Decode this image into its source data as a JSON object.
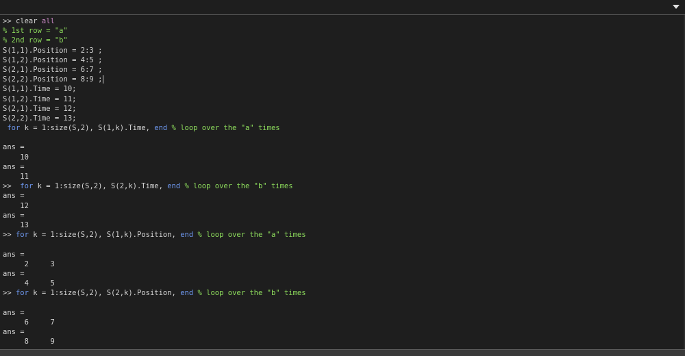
{
  "colors": {
    "background": "#1e1e1e",
    "text": "#d4d4d4",
    "comment": "#8bd85b",
    "keyword": "#6c95eb",
    "string_keyword": "#c586c0"
  },
  "toolbar": {
    "dropdown_icon": "chevron-down-icon"
  },
  "console": {
    "lines": [
      [
        {
          "t": ">> clear ",
          "c": "white"
        },
        {
          "t": "all",
          "c": "violet"
        }
      ],
      [
        {
          "t": "% 1st row = \"a\"",
          "c": "green"
        }
      ],
      [
        {
          "t": "% 2nd row = \"b\"",
          "c": "green"
        }
      ],
      [
        {
          "t": "S(1,1).Position = 2:3 ;",
          "c": "white"
        }
      ],
      [
        {
          "t": "S(1,2).Position = 4:5 ;",
          "c": "white"
        }
      ],
      [
        {
          "t": "S(2,1).Position = 6:7 ;",
          "c": "white"
        }
      ],
      [
        {
          "t": "S(2,2).Position = 8:9 ;",
          "c": "white"
        },
        {
          "caret": true
        }
      ],
      [
        {
          "t": "S(1,1).Time = 10;",
          "c": "white"
        }
      ],
      [
        {
          "t": "S(1,2).Time = 11;",
          "c": "white"
        }
      ],
      [
        {
          "t": "S(2,1).Time = 12;",
          "c": "white"
        }
      ],
      [
        {
          "t": "S(2,2).Time = 13;",
          "c": "white"
        }
      ],
      [
        {
          "t": " ",
          "c": "white"
        },
        {
          "t": "for",
          "c": "blue"
        },
        {
          "t": " k = 1:size(S,2), S(1,k).Time, ",
          "c": "white"
        },
        {
          "t": "end",
          "c": "blue"
        },
        {
          "t": " % loop over the \"a\" times",
          "c": "green"
        }
      ],
      [],
      [
        {
          "t": "ans =",
          "c": "white"
        }
      ],
      [
        {
          "t": "    10",
          "c": "white"
        }
      ],
      [
        {
          "t": "ans =",
          "c": "white"
        }
      ],
      [
        {
          "t": "    11",
          "c": "white"
        }
      ],
      [
        {
          "t": ">>  ",
          "c": "white"
        },
        {
          "t": "for",
          "c": "blue"
        },
        {
          "t": " k = 1:size(S,2), S(2,k).Time, ",
          "c": "white"
        },
        {
          "t": "end",
          "c": "blue"
        },
        {
          "t": " % loop over the \"b\" times",
          "c": "green"
        }
      ],
      [
        {
          "t": "ans =",
          "c": "white"
        }
      ],
      [
        {
          "t": "    12",
          "c": "white"
        }
      ],
      [
        {
          "t": "ans =",
          "c": "white"
        }
      ],
      [
        {
          "t": "    13",
          "c": "white"
        }
      ],
      [
        {
          "t": ">> ",
          "c": "white"
        },
        {
          "t": "for",
          "c": "blue"
        },
        {
          "t": " k = 1:size(S,2), S(1,k).Position, ",
          "c": "white"
        },
        {
          "t": "end",
          "c": "blue"
        },
        {
          "t": " % loop over the \"a\" times",
          "c": "green"
        }
      ],
      [],
      [
        {
          "t": "ans =",
          "c": "white"
        }
      ],
      [
        {
          "t": "     2     3",
          "c": "white"
        }
      ],
      [
        {
          "t": "ans =",
          "c": "white"
        }
      ],
      [
        {
          "t": "     4     5",
          "c": "white"
        }
      ],
      [
        {
          "t": ">> ",
          "c": "white"
        },
        {
          "t": "for",
          "c": "blue"
        },
        {
          "t": " k = 1:size(S,2), S(2,k).Position, ",
          "c": "white"
        },
        {
          "t": "end",
          "c": "blue"
        },
        {
          "t": " % loop over the \"b\" times",
          "c": "green"
        }
      ],
      [],
      [
        {
          "t": "ans =",
          "c": "white"
        }
      ],
      [
        {
          "t": "     6     7",
          "c": "white"
        }
      ],
      [
        {
          "t": "ans =",
          "c": "white"
        }
      ],
      [
        {
          "t": "     8     9",
          "c": "white"
        }
      ],
      [
        {
          "t": ">>",
          "c": "white"
        }
      ]
    ]
  }
}
